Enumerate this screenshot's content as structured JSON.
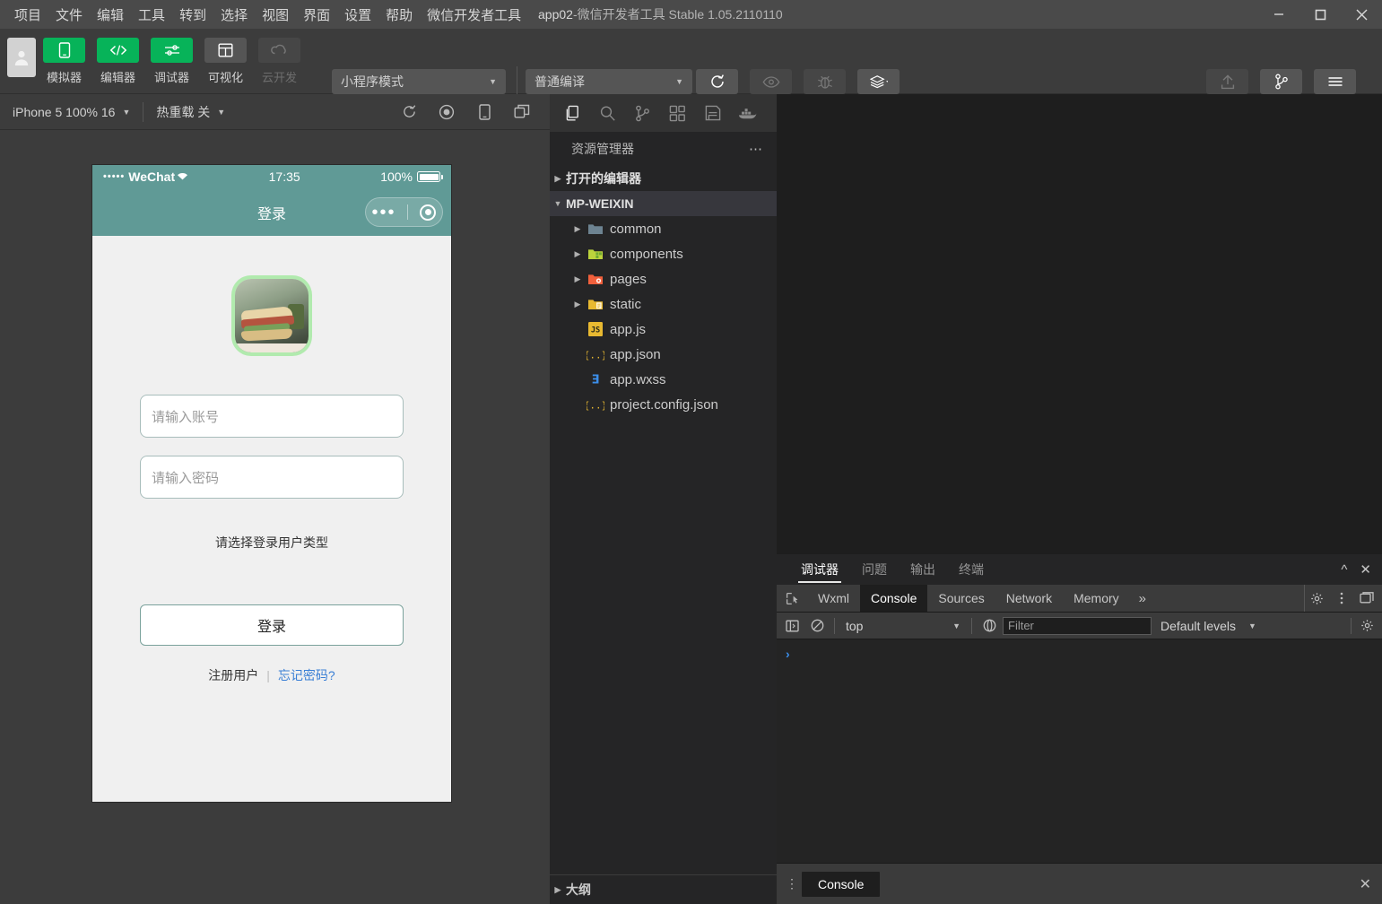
{
  "window": {
    "title_app": "app02",
    "title_sep": " - ",
    "title_rest": "微信开发者工具 Stable 1.05.2110110",
    "minimize": "—",
    "maximize": "□",
    "close": "✕"
  },
  "menu": {
    "items": [
      {
        "label": "项目"
      },
      {
        "label": "文件"
      },
      {
        "label": "编辑"
      },
      {
        "label": "工具"
      },
      {
        "label": "转到"
      },
      {
        "label": "选择"
      },
      {
        "label": "视图"
      },
      {
        "label": "界面"
      },
      {
        "label": "设置"
      },
      {
        "label": "帮助"
      },
      {
        "label": "微信开发者工具"
      }
    ]
  },
  "toolbar": {
    "left_buttons": [
      {
        "label": "模拟器",
        "icon": "phone-icon",
        "state": "green"
      },
      {
        "label": "编辑器",
        "icon": "code-icon",
        "state": "green"
      },
      {
        "label": "调试器",
        "icon": "sliders-icon",
        "state": "green"
      },
      {
        "label": "可视化",
        "icon": "layout-icon",
        "state": "gray"
      },
      {
        "label": "云开发",
        "icon": "cloud-icon",
        "state": "disabled"
      }
    ],
    "mode_select": "小程序模式",
    "compile_select": "普通编译",
    "center_buttons": [
      {
        "label": "编译",
        "icon": "refresh-icon",
        "state": "gray"
      },
      {
        "label": "预览",
        "icon": "eye-icon",
        "state": "disabled"
      },
      {
        "label": "真机调试",
        "icon": "bug-icon",
        "state": "disabled"
      },
      {
        "label": "清缓存",
        "icon": "layers-icon",
        "state": "gray"
      }
    ],
    "right_buttons": [
      {
        "label": "上传",
        "icon": "upload-icon",
        "state": "disabled"
      },
      {
        "label": "版本管理",
        "icon": "branch-icon",
        "state": "gray"
      },
      {
        "label": "详情",
        "icon": "menu-icon",
        "state": "gray"
      }
    ]
  },
  "simulator": {
    "device_chip": "iPhone 5 100% 16",
    "hotreload_chip": "热重载 关",
    "icons": [
      "refresh-icon",
      "record-icon",
      "phone-icon",
      "windows-icon"
    ]
  },
  "phone": {
    "status": {
      "signal_dots": "•••••",
      "carrier": "WeChat",
      "wifi": "⌃",
      "time": "17:35",
      "battery_pct": "100%"
    },
    "nav_title": "登录",
    "form": {
      "account_placeholder": "请输入账号",
      "password_placeholder": "请输入密码",
      "type_label": "请选择登录用户类型",
      "login_button": "登录",
      "register_link": "注册用户",
      "link_separator": "|",
      "forgot_link": "忘记密码?"
    }
  },
  "explorer": {
    "activity_icons": [
      {
        "name": "files-icon",
        "active": true
      },
      {
        "name": "search-icon",
        "active": false
      },
      {
        "name": "source-control-icon",
        "active": false
      },
      {
        "name": "extensions-icon",
        "active": false
      },
      {
        "name": "save-icon",
        "active": false
      },
      {
        "name": "docker-icon",
        "active": false
      }
    ],
    "header_title": "资源管理器",
    "header_more": "⋯",
    "open_editors": "打开的编辑器",
    "project_root": "MP-WEIXIN",
    "tree": [
      {
        "label": "common",
        "type": "folder",
        "icon_color": "#6d8391"
      },
      {
        "label": "components",
        "type": "folder",
        "icon_color": "#bcd33c"
      },
      {
        "label": "pages",
        "type": "folder",
        "icon_color": "#f2603c"
      },
      {
        "label": "static",
        "type": "folder",
        "icon_color": "#e8b931"
      },
      {
        "label": "app.js",
        "type": "file",
        "icon": "js-icon"
      },
      {
        "label": "app.json",
        "type": "file",
        "icon": "json-icon"
      },
      {
        "label": "app.wxss",
        "type": "file",
        "icon": "css-icon"
      },
      {
        "label": "project.config.json",
        "type": "file",
        "icon": "json-icon"
      }
    ],
    "outline": "大纲"
  },
  "debugger": {
    "panel_tabs": [
      {
        "label": "调试器",
        "active": true
      },
      {
        "label": "问题",
        "active": false
      },
      {
        "label": "输出",
        "active": false
      },
      {
        "label": "终端",
        "active": false
      }
    ],
    "collapse_icon": "^",
    "close_icon": "✕",
    "devtools_tabs": [
      {
        "label": "Wxml",
        "active": false
      },
      {
        "label": "Console",
        "active": true
      },
      {
        "label": "Sources",
        "active": false
      },
      {
        "label": "Network",
        "active": false
      },
      {
        "label": "Memory",
        "active": false
      }
    ],
    "more_tabs": "»",
    "console": {
      "context": "top",
      "filter_placeholder": "Filter",
      "levels": "Default levels",
      "prompt": "›"
    },
    "drawer": {
      "kebab": "⋮",
      "tab": "Console",
      "close": "✕"
    }
  },
  "colors": {
    "accent_green": "#07b359",
    "phone_teal": "#609a96",
    "link_blue": "#3a7fd5",
    "titlebar_bg": "#4a4a4a",
    "toolbar_bg": "#3c3c3c",
    "explorer_bg": "#252526",
    "editor_bg": "#1e1e1e"
  }
}
